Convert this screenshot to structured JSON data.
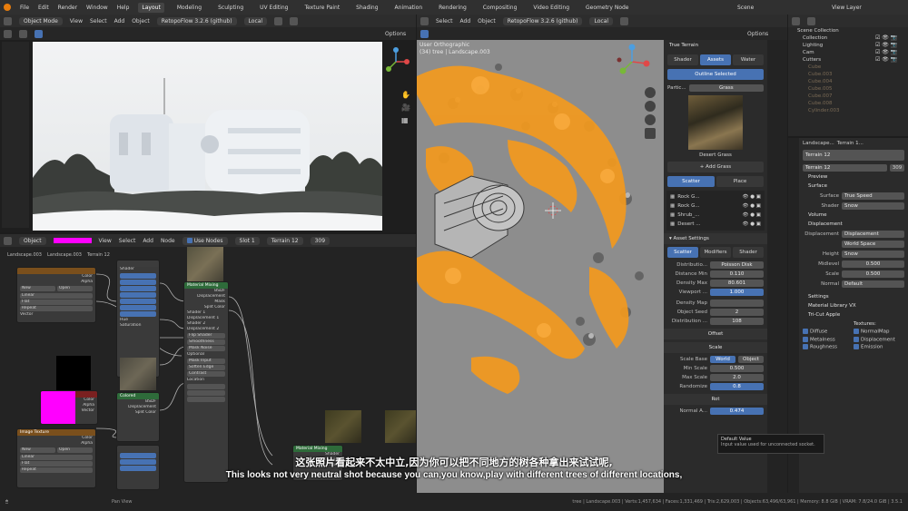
{
  "menu": {
    "items": [
      "File",
      "Edit",
      "Render",
      "Window",
      "Help"
    ],
    "workspaces": [
      "Layout",
      "Modeling",
      "Sculpting",
      "UV Editing",
      "Texture Paint",
      "Shading",
      "Animation",
      "Rendering",
      "Compositing",
      "Video Editing",
      "Geometry Node"
    ],
    "active_workspace": "Layout",
    "scene_label": "Scene",
    "view_layer_label": "View Layer"
  },
  "left_viewport": {
    "header": {
      "mode": "Object Mode",
      "menus": [
        "View",
        "Select",
        "Add",
        "Object"
      ],
      "addon": "RetopoFlow 3.2.6 (github)",
      "transform": "Local",
      "options": "Options"
    }
  },
  "right_viewport": {
    "header": {
      "menus": [
        "Select",
        "Add",
        "Object"
      ],
      "addon": "RetopoFlow 3.2.6 (github)",
      "transform": "Local",
      "options": "Options"
    },
    "overlay_title": "User Orthographic",
    "overlay_subtitle": "(34) tree | Landscape.003"
  },
  "node_editor": {
    "header": {
      "type": "Object",
      "menus": [
        "View",
        "Select",
        "Add",
        "Node"
      ],
      "use_nodes": "Use Nodes",
      "slot": "Slot 1",
      "material": "Terrain 12",
      "users": "309"
    },
    "breadcrumb": [
      "Landscape.003",
      "Landscape.003",
      "Terrain 12"
    ],
    "nodes": {
      "a": {
        "title": "",
        "rows": [
          "Color",
          "Alpha"
        ],
        "fields": [
          "New",
          "Open",
          "Linear",
          "Flat",
          "Repeat",
          "Vector"
        ]
      },
      "b": {
        "title": "",
        "rows": [
          "Color",
          "Alpha",
          "Vector"
        ]
      },
      "c": {
        "title": "Image Texture",
        "rows": [
          "Color",
          "Alpha"
        ],
        "fields": [
          "New",
          "Open",
          "Linear",
          "Flat",
          "Repeat",
          "Vector"
        ]
      },
      "d": {
        "title": "",
        "rows": [
          "Shader",
          "Hue",
          "Saturation"
        ]
      },
      "e": {
        "title": "Material Mixing",
        "rows": [
          "BSDF",
          "Displacement",
          "Mask",
          "Split Color",
          "Shader 1",
          "Displacement 1",
          "Shader 2",
          "Displacement 2",
          "Flip Shader",
          "Smoothness",
          "Mask Noise",
          "Optional",
          "Mask Input",
          "Soften Edge",
          "Contrast",
          "Location"
        ]
      },
      "f": {
        "title": "Material Mixing",
        "rows": [
          "Shader",
          "Displacement",
          "Mask"
        ]
      },
      "g": {
        "title": "Colored",
        "rows": [
          "BSDF",
          "Displacement",
          "Split Color"
        ]
      }
    }
  },
  "true_terrain": {
    "title": "True Terrain",
    "tabs": [
      "Shader",
      "Assets",
      "Water"
    ],
    "active_tab": "Assets",
    "outline_selected": "Outline Selected",
    "particle_label": "Partic...",
    "particle_value": "Grass",
    "preview_caption": "Desert Grass",
    "add_button": "Add Grass",
    "mode_tabs": [
      "Scatter",
      "Place"
    ],
    "active_mode": "Scatter",
    "assets": [
      "Rock G...",
      "Rock G...",
      "Shrub_...",
      "Desert ..."
    ],
    "asset_settings": "Asset Settings",
    "settings_tabs": [
      "Scatter",
      "Modifiers",
      "Shader"
    ],
    "fields": [
      {
        "key": "Distributio...",
        "value": "Poisson Disk"
      },
      {
        "key": "Distance Min",
        "value": "0.110"
      },
      {
        "key": "Density Max",
        "value": "80.601"
      },
      {
        "key": "Viewport ...",
        "value": "1.000"
      }
    ],
    "density_map": "Density Map",
    "object_seed_key": "Object Seed",
    "object_seed": "2",
    "distribution_seed_key": "Distribution ...",
    "distribution_seed": "108",
    "offset": "Offset",
    "scale": "Scale",
    "scale_base_key": "Scale Base",
    "scale_base_options": [
      "World",
      "Object"
    ],
    "scale_fields": [
      {
        "key": "Min Scale",
        "value": "0.500"
      },
      {
        "key": "Max Scale",
        "value": "2.0"
      },
      {
        "key": "Randomize",
        "value": "0.8"
      }
    ],
    "rot": "Rot",
    "normal_a_key": "Normal A...",
    "normal_a": "0.474"
  },
  "tooltip": {
    "title": "Default Value",
    "body": "Input value used for unconnected socket."
  },
  "outliner": {
    "items": [
      {
        "name": "Scene Collection",
        "style": "normal"
      },
      {
        "name": "Collection",
        "style": "normal"
      },
      {
        "name": "Lighting",
        "style": "normal"
      },
      {
        "name": "Cam",
        "style": "normal"
      },
      {
        "name": "Cutters",
        "style": "normal"
      },
      {
        "name": "Cube",
        "style": "dim"
      },
      {
        "name": "Cube.003",
        "style": "dim"
      },
      {
        "name": "Cube.004",
        "style": "dim"
      },
      {
        "name": "Cube.005",
        "style": "dim"
      },
      {
        "name": "Cube.007",
        "style": "dim"
      },
      {
        "name": "Cube.008",
        "style": "dim"
      },
      {
        "name": "Cylinder.003",
        "style": "dim"
      }
    ]
  },
  "properties": {
    "breadcrumb": [
      "Landscape...",
      "Terrain 1..."
    ],
    "material_slot": "Terrain 12",
    "material_name": "Terrain 12",
    "users": "309",
    "sections": {
      "preview": "Preview",
      "surface": "Surface",
      "volume": "Volume",
      "displacement": "Displacement",
      "settings": "Settings",
      "library": "Material Library VX",
      "tli": "Tri-Cut Apple"
    },
    "surface_key": "Surface",
    "surface_value": "True Speed",
    "shader_key": "Shader",
    "shader_value": "Snow",
    "disp_key": "Displacement",
    "disp_value": "Displacement",
    "space_value": "World Space",
    "height_key": "Height",
    "height_value": "Snow",
    "midlevel_key": "Midlevel",
    "midlevel_value": "0.500",
    "scale_key": "Scale",
    "scale_value": "0.500",
    "normal_key": "Normal",
    "normal_value": "Default",
    "textures_label": "Textures:",
    "checks": [
      "Diffuse",
      "NormalMap",
      "Metalness",
      "Displacement",
      "Roughness",
      "Emission"
    ]
  },
  "status": {
    "left": "Pan View",
    "right": "tree | Landscape.003 | Verts:1,457,634 | Faces:1,331,469 | Tris:2,629,003 | Objects:63,496/63,961 | Memory: 8.8 GiB | VRAM: 7.8/24.0 GiB | 3.5.1"
  },
  "subtitles": {
    "chinese": "这张照片看起来不太中立,因为你可以把不同地方的树各种拿出来试试呢,",
    "english": "This looks not very neutral shot because you can,you know,play with different trees of different locations,"
  }
}
